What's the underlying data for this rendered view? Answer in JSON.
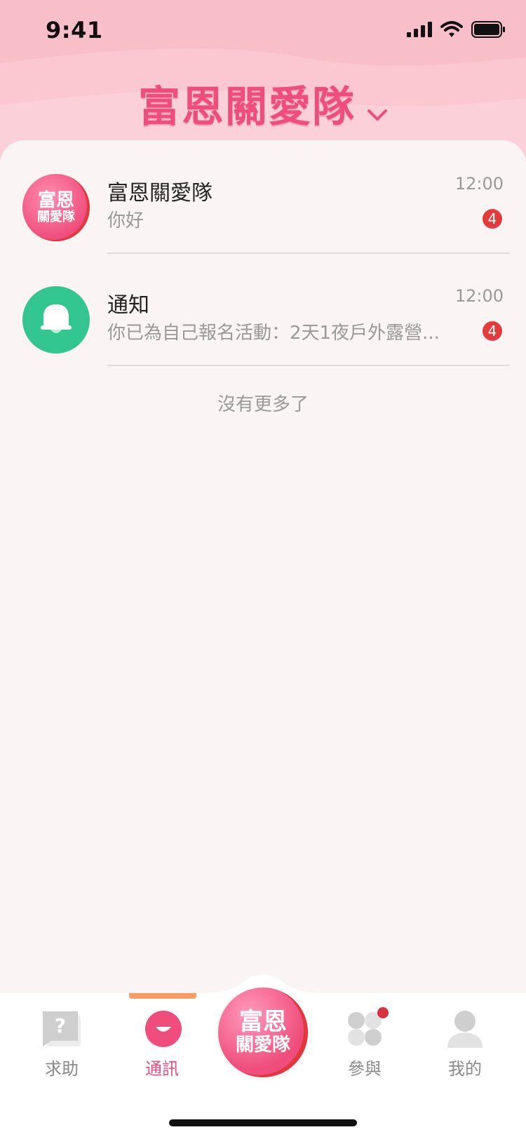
{
  "status_bar": {
    "time": "9:41",
    "icons": [
      "signal-icon",
      "wifi-icon",
      "battery-icon"
    ]
  },
  "header": {
    "title": "富恩關愛隊",
    "dropdown_icon": "chevron-down-icon"
  },
  "conversations": [
    {
      "avatar_text_line1": "富恩",
      "avatar_text_line2": "關愛隊",
      "title": "富恩關愛隊",
      "preview": "你好",
      "time": "12:00",
      "unread": "4"
    },
    {
      "avatar_icon": "bell-icon",
      "title": "通知",
      "preview": "你已為自己報名活動：2天1夜戶外露營...",
      "time": "12:00",
      "unread": "4"
    }
  ],
  "list_footer": "沒有更多了",
  "tabbar": {
    "tabs": [
      {
        "label": "求助",
        "icon": "help-icon"
      },
      {
        "label": "通訊",
        "icon": "chat-icon",
        "active": true
      },
      {
        "label": "參與",
        "icon": "grid-icon",
        "has_dot": true
      },
      {
        "label": "我的",
        "icon": "profile-icon"
      }
    ],
    "center": {
      "line1": "富恩",
      "line2": "關愛隊"
    }
  },
  "colors": {
    "brand": "#ef4d7b",
    "header_bg": "#f9bfc9",
    "badge": "#e23b3b",
    "notify": "#34c690",
    "indicator": "#f89c63"
  }
}
